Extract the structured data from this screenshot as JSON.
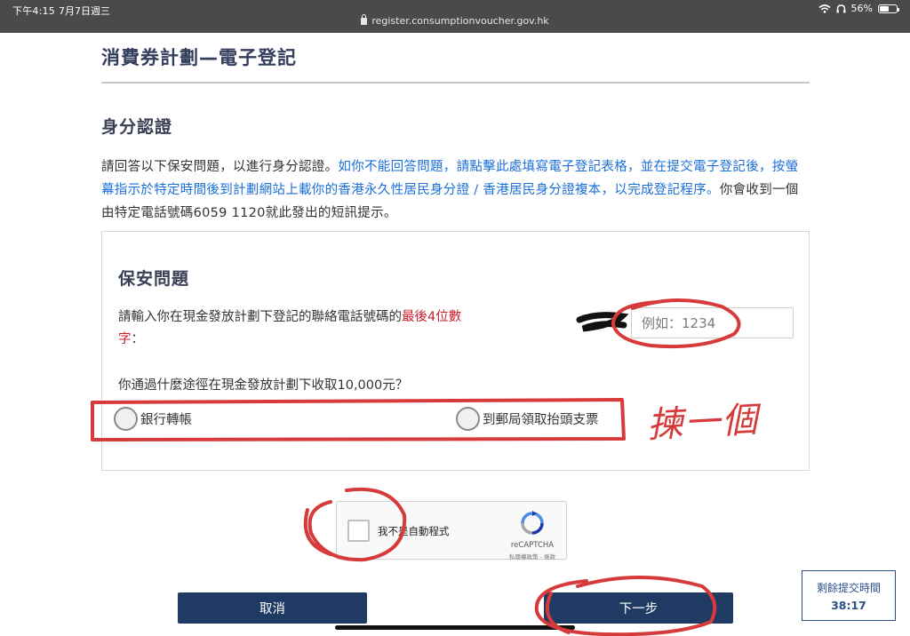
{
  "status_bar": {
    "time": "下午4:15",
    "date": "7月7日週三",
    "url": "register.consumptionvoucher.gov.hk",
    "battery": "56%",
    "battery_level": 0.56
  },
  "page": {
    "title": "消費券計劃—電子登記",
    "section_title": "身分認證",
    "intro_before": "請回答以下保安問題，以進行身分認證。",
    "intro_link": "如你不能回答問題，請點擊此處填寫電子登記表格，並在提交電子登記後，按螢幕指示於特定時間後到計劃網站上載你的香港永久性居民身分證 / 香港居民身分證複本，以完成登記程序。",
    "intro_after": "你會收到一個由特定電話號碼6059 1120就此發出的短訊提示。"
  },
  "security": {
    "title": "保安問題",
    "q1_before": "請輸入你在現金發放計劃下登記的聯絡電話號碼的",
    "q1_highlight": "最後4位數字",
    "q1_after": "：",
    "q1_placeholder": "例如：1234",
    "q2": "你通過什麼途徑在現金發放計劃下收取10,000元？",
    "options": [
      "銀行轉帳",
      "到郵局領取抬頭支票"
    ]
  },
  "captcha": {
    "label": "我不是自動程式",
    "brand": "reCAPTCHA",
    "terms": "私隱權政策 - 條款"
  },
  "buttons": {
    "cancel": "取消",
    "next": "下一步"
  },
  "timer": {
    "label": "剩餘提交時間",
    "value": "38:17"
  },
  "annotation": {
    "text": "揀一個",
    "color": "#d63a3a"
  },
  "colors": {
    "primary_button": "#1f3a63",
    "link": "#1a6fd8",
    "highlight": "#c8202e"
  }
}
